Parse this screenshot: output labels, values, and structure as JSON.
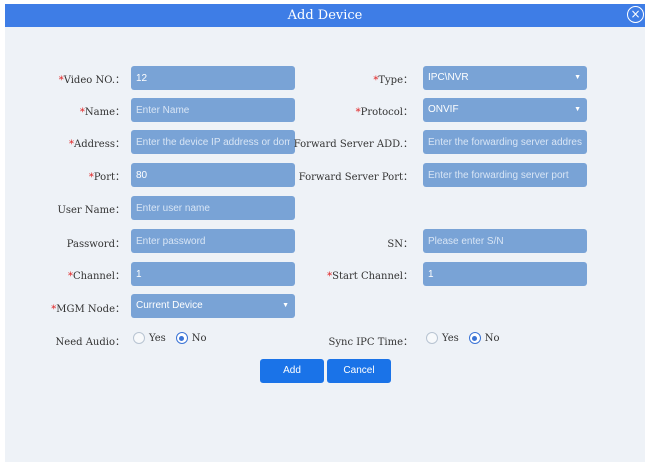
{
  "dialog": {
    "title": "Add Device"
  },
  "fields": {
    "video_no": {
      "label": "Video NO.：",
      "required": "*",
      "value": "12"
    },
    "type": {
      "label": "Type：",
      "required": "*",
      "value": "IPC\\NVR"
    },
    "name": {
      "label": "Name：",
      "required": "*",
      "value": "",
      "placeholder": "Enter Name"
    },
    "protocol": {
      "label": "Protocol：",
      "required": "*",
      "value": "ONVIF"
    },
    "address": {
      "label": "Address：",
      "required": "*",
      "value": "",
      "placeholder": "Enter the device IP address or domain"
    },
    "forward_server_addr": {
      "label": "Forward Server ADD.：",
      "value": "",
      "placeholder": "Enter the forwarding server address"
    },
    "port": {
      "label": "Port：",
      "required": "*",
      "value": "80"
    },
    "forward_server_port": {
      "label": "Forward Server Port：",
      "value": "",
      "placeholder": "Enter the forwarding server port"
    },
    "user_name": {
      "label": "User Name：",
      "value": "",
      "placeholder": "Enter user name"
    },
    "password": {
      "label": "Password：",
      "value": "",
      "placeholder": "Enter password"
    },
    "sn": {
      "label": "SN：",
      "value": "",
      "placeholder": "Please enter S/N"
    },
    "channel": {
      "label": "Channel：",
      "required": "*",
      "value": "1"
    },
    "start_channel": {
      "label": "Start Channel：",
      "required": "*",
      "value": "1"
    },
    "mgm_node": {
      "label": "MGM Node：",
      "required": "*",
      "value": "Current Device"
    },
    "need_audio": {
      "label": "Need Audio：",
      "options": [
        "Yes",
        "No"
      ],
      "selected": "No"
    },
    "sync_ipc_time": {
      "label": "Sync IPC Time：",
      "options": [
        "Yes",
        "No"
      ],
      "selected": "No"
    }
  },
  "buttons": {
    "add": "Add",
    "cancel": "Cancel"
  },
  "colors": {
    "titlebar": "#3e7de6",
    "input": "#79a3d6",
    "button": "#1a73e8",
    "required": "#e02020"
  },
  "icons": {
    "close": "close-circle-icon",
    "dropdown": "caret-down-icon"
  }
}
